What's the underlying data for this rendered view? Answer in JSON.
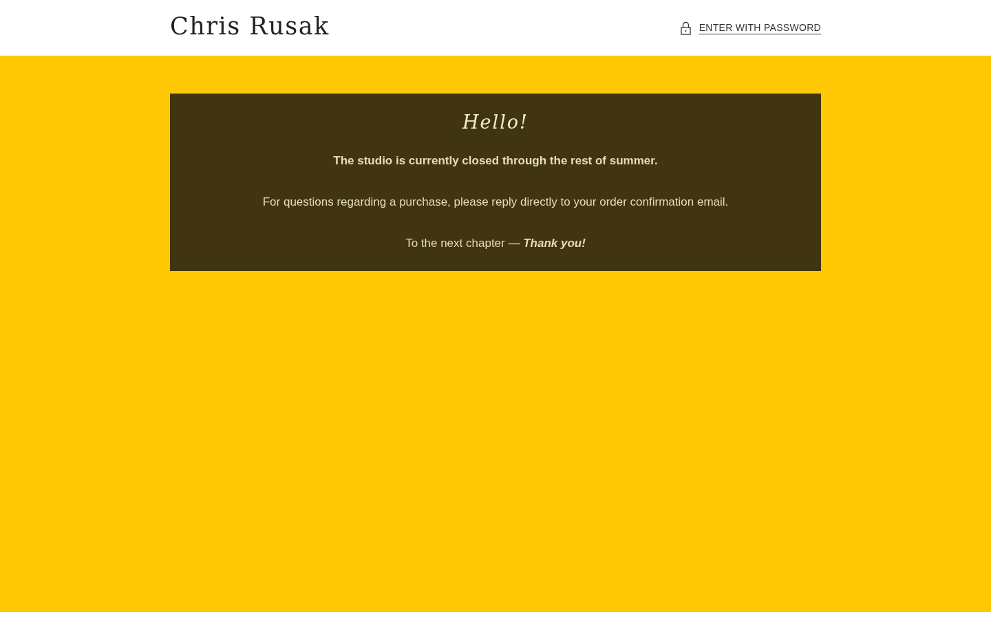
{
  "header": {
    "logo": "Chris Rusak",
    "password_link": "ENTER WITH PASSWORD"
  },
  "notice": {
    "title": "Hello!",
    "lead": "The studio is currently closed through the rest of summer.",
    "paragraphs": [
      {
        "text": "For questions regarding a purchase, please reply directly to your order confirmation email."
      },
      {
        "text": "To the next chapter —",
        "emphasis": "Thank you!"
      }
    ]
  }
}
